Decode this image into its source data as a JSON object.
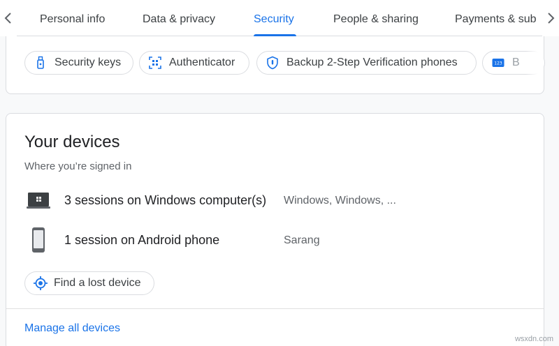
{
  "tabs": [
    {
      "label": "Personal info"
    },
    {
      "label": "Data & privacy"
    },
    {
      "label": "Security",
      "active": true
    },
    {
      "label": "People & sharing"
    },
    {
      "label": "Payments & sub"
    }
  ],
  "nav": {
    "prev_icon": "chevron-left-icon",
    "next_icon": "chevron-right-icon"
  },
  "two_step_chips": [
    {
      "label": "Security keys",
      "icon": "security-key-icon"
    },
    {
      "label": "Authenticator",
      "icon": "qr-scan-icon"
    },
    {
      "label": "Backup 2-Step Verification phones",
      "icon": "shield-icon"
    },
    {
      "label": "B",
      "icon": "backup-codes-icon"
    }
  ],
  "devices": {
    "title": "Your devices",
    "subtitle": "Where you’re signed in",
    "items": [
      {
        "name": "3 sessions on Windows computer(s)",
        "detail": "Windows, Windows, ...",
        "icon": "windows-laptop-icon"
      },
      {
        "name": "1 session on Android phone",
        "detail": "Sarang",
        "icon": "android-phone-icon"
      }
    ],
    "find_button": "Find a lost device",
    "manage_link": "Manage all devices"
  },
  "watermark": "wsxdn.com",
  "colors": {
    "accent": "#1a73e8",
    "border": "#dadce0",
    "text": "#202124",
    "muted": "#5f6368"
  }
}
